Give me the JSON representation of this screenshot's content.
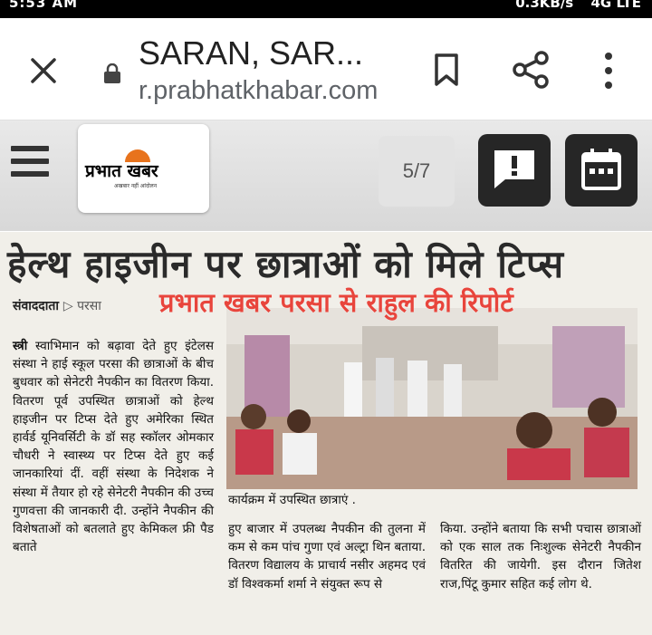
{
  "status_bar": {
    "time": "5:53 AM",
    "speed": "0.3KB/s",
    "network": "4G LTE"
  },
  "url_bar": {
    "title": "SARAN, SAR...",
    "domain": "r.prabhatkhabar.com"
  },
  "toolbar": {
    "logo_text": "प्रभात खबर",
    "logo_tagline": "अखबार नहीं आंदोलन",
    "page_indicator": "5/7"
  },
  "article": {
    "headline": "हेल्थ हाइजीन पर छात्राओं को मिले टिप्स",
    "byline_author": "संवाददाता",
    "byline_place": "परसा",
    "overlay_text": "प्रभात खबर परसा से राहुल की रिपोर्ट",
    "photo_caption": "कार्यक्रम में उपस्थित छात्राएं .",
    "col1_drop": "स्त्री",
    "col1_text": " स्वाभिमान को बढ़ावा देते हुए इंटेलस संस्था ने हाई स्कूल परसा की छात्राओं के बीच बुधवार को सेनेटरी नैपकीन का वितरण किया. वितरण पूर्व उपस्थित छात्राओं को हेल्थ हाइजीन पर टिप्स देते हुए अमेरिका स्थित हार्वर्ड यूनिवर्सिटी के डॉ सह स्कॉलर ओमकार चौधरी ने स्वास्थ्य पर टिप्स देते हुए कई जानकारियां दीं. वहीं संस्था के निदेशक ने संस्था में तैयार हो रहे सेनेटरी नैपकीन की उच्च गुणवत्ता की जानकारी दी. उन्होंने नैपकीन की विशेषताओं को बतलाते हुए केमिकल फ्री पैड बताते",
    "col2_text": "हुए बाजार में उपलब्ध नैपकीन की तुलना में कम से कम पांच गुणा एवं अल्ट्रा थिन बताया. वितरण विद्यालय के प्राचार्य नसीर अहमद एवं डॉ विश्वकर्मा शर्मा ने संयुक्त रूप से",
    "col3_text": "किया. उन्होंने बताया कि सभी पचास छात्राओं को एक साल तक निःशुल्क सेनेटरी नैपकीन वितरित की जायेगी. इस दौरान जितेश राज,पिंटू कुमार सहित कई लोग थे."
  },
  "colors": {
    "overlay_red": "#e8453c",
    "logo_orange": "#e8731c",
    "dark_button": "#262626"
  },
  "icons": [
    "close-icon",
    "lock-icon",
    "bookmark-icon",
    "share-icon",
    "more-vert-icon",
    "menu-icon",
    "feedback-icon",
    "calendar-icon"
  ]
}
